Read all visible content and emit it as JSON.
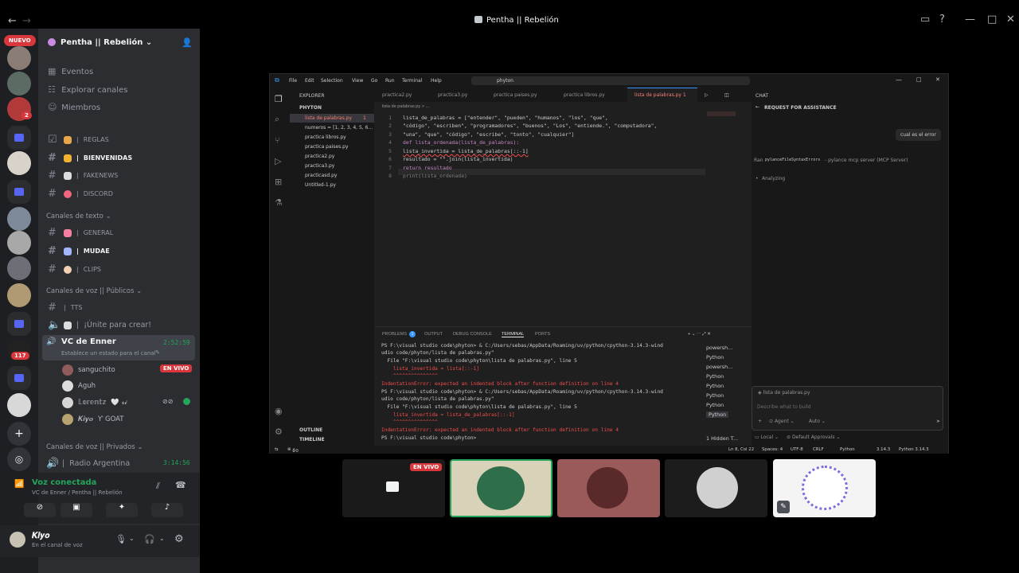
{
  "window": {
    "title": "Pentha || Rebelión"
  },
  "servers": {
    "new_badge": "NUEVO",
    "badges": [
      "2",
      "117"
    ]
  },
  "sidebar": {
    "guild_name": "Pentha || Rebelión",
    "top_items": [
      "Eventos",
      "Explorar canales",
      "Miembros"
    ],
    "channels_a": [
      "REGLAS",
      "BIENVENIDAS",
      "FAKENEWS",
      "DISCORD"
    ],
    "category_text": "Canales de texto",
    "channels_b": [
      "GENERAL",
      "MUDAE",
      "CLIPS"
    ],
    "category_voice_public": "Canales de voz || Públicos",
    "voice_public": [
      "TTS",
      "¡Únite para crear!"
    ],
    "vc_enner": {
      "name": "VC de Enner",
      "time": "2:52:59",
      "status": "Establece un estado para el canal"
    },
    "users": [
      {
        "name": "sanguchito",
        "live": "EN VIVO"
      },
      {
        "name": "Aguh"
      },
      {
        "name": "𝕃𝕠𝕣𝕖𝕟𝕥𝕫",
        "extra": "🤍 𝓻𝓲"
      },
      {
        "name": "𝑲𝒊𝒚𝒐",
        "extra": "Ƴ GOAT"
      }
    ],
    "category_voice_private": "Canales de voz || Privados",
    "radio": {
      "name": "Radio Argentina",
      "time": "3:14:56"
    }
  },
  "voice_panel": {
    "status": "Voz conectada",
    "location": "VC de Enner / Pentha || Rebelión"
  },
  "user_panel": {
    "name": "𝑲𝒊𝒚𝒐",
    "status": "En el canal de voz"
  },
  "vscode": {
    "menu": [
      "File",
      "Edit",
      "Selection",
      "View",
      "Go",
      "Run",
      "Terminal",
      "Help"
    ],
    "search": "phyton",
    "explorer_title": "EXPLORER",
    "folder": "PHYTON",
    "files": [
      "lista de palabras.py",
      "numeros = [1, 2, 3, 4, 5, 6...",
      "practica libros.py",
      "practica paises.py",
      "practica2.py",
      "practica3.py",
      "practicasd.py",
      "Untitled-1.py"
    ],
    "active_file_badge": "1",
    "outline": "OUTLINE",
    "timeline": "TIMELINE",
    "tabs": [
      "practica2.py",
      "practica3.py",
      "practica paises.py",
      "practica libros.py",
      "lista de palabras.py 1"
    ],
    "breadcrumb": "lista de palabras.py > ...",
    "code": [
      "lista_de_palabras = [\"entender\", \"pueden\", \"humanos\", \"los\", \"que\",",
      "\"código\", \"escriben\", \"programadores\", \"buenos\", \"Los\", \"entiende.\", \"computadora\",",
      "\"una\", \"que\", \"código\", \"escribe\", \"tonto\", \"cualquier\"]",
      "def lista_ordenada(lista_de_palabras):",
      "lista_invertida = lista_de_palabras[::-1]",
      "resultado = \"\".join(lista_invertida)",
      "return resultado",
      "print(lista_ordenada)"
    ],
    "panel_tabs": [
      "PROBLEMS",
      "OUTPUT",
      "DEBUG CONSOLE",
      "TERMINAL",
      "PORTS"
    ],
    "problems_count": "1",
    "terminal": [
      "PS F:\\visual studio code\\phyton> & C:/Users/sebas/AppData/Roaming/uv/python/cpython-3.14.3-wind",
      "udio code/phyton/lista de palabras.py\"",
      "  File \"F:\\visual studio code\\phyton\\lista de palabras.py\", line 5",
      "    lista_invertida = lista[::-1]",
      "    ^^^^^^^^^^^^^^^",
      "IndentationError: expected an indented block after function definition on line 4",
      "PS F:\\visual studio code\\phyton> & C:/Users/sebas/AppData/Roaming/uv/python/cpython-3.14.3-wind",
      "udio code/phyton/lista de palabras.py\"",
      "  File \"F:\\visual studio code\\phyton\\lista de palabras.py\", line 5",
      "    lista_invertida = lista_de_palabras[::-1]",
      "    ^^^^^^^^^^^^^^^",
      "IndentationError: expected an indented block after function definition on line 4",
      "PS F:\\visual studio code\\phyton>"
    ],
    "terminals": [
      "powersh...",
      "Python",
      "powersh...",
      "Python",
      "Python",
      "Python",
      "Python",
      "Python"
    ],
    "hidden": "1 Hidden T...",
    "chat": {
      "header": "CHAT",
      "title": "REQUEST FOR ASSISTANCE",
      "user_msg": "cual es el error",
      "ran": "Ran",
      "ran_tool": "pylanceFileSyntaxErrors",
      "ran_server": "- pylance mcp server (MCP Server)",
      "analyzing": "Analyzing",
      "context_file": "lista de palabras.py",
      "placeholder": "Describe what to build",
      "agent": "Agent",
      "auto": "Auto",
      "local": "Local",
      "approvals": "Default Approvals"
    },
    "status": {
      "errors": "1",
      "warnings": "0",
      "position": "Ln 8, Col 22",
      "spaces": "Spaces: 4",
      "encoding": "UTF-8",
      "eol": "CRLF",
      "lang": "Python",
      "version": "3.14.3",
      "interp": "Python 3.14.3"
    }
  },
  "stream_tiles": {
    "live_badge": "EN VIVO"
  }
}
